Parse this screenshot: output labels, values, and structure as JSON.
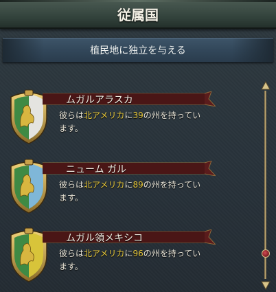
{
  "header": {
    "title": "従属国"
  },
  "actions": {
    "grant_independence_label": "植民地に独立を与える"
  },
  "colors": {
    "highlight": "#e6c73a",
    "banner": "#5a1c1c",
    "shield_frame": "#c8a24a"
  },
  "subjects": [
    {
      "name": "ムガルアラスカ",
      "desc_prefix": "彼らは",
      "region": "北アメリカ",
      "desc_mid": "に",
      "count": "39",
      "desc_suffix_line1": "の州を持ってい",
      "desc_line2": "ます。",
      "shield_icon": "griffin-shield-icon",
      "shield_left_color": "#3f8a44",
      "shield_right_color": "#e4e4e0"
    },
    {
      "name": "ニューム ガル",
      "desc_prefix": "彼らは",
      "region": "北アメリカ",
      "desc_mid": "に",
      "count": "89",
      "desc_suffix_line1": "の州を持ってい",
      "desc_line2": "ます。",
      "shield_icon": "griffin-shield-icon",
      "shield_left_color": "#3f8a44",
      "shield_right_color": "#7fb7d8"
    },
    {
      "name": "ムガル領メキシコ",
      "desc_prefix": "彼らは",
      "region": "北アメリカ",
      "desc_mid": "に",
      "count": "96",
      "desc_suffix_line1": "の州を持ってい",
      "desc_line2": "ます。",
      "shield_icon": "griffin-shield-icon",
      "shield_left_color": "#3f8a44",
      "shield_right_color": "#d8c43a"
    }
  ]
}
